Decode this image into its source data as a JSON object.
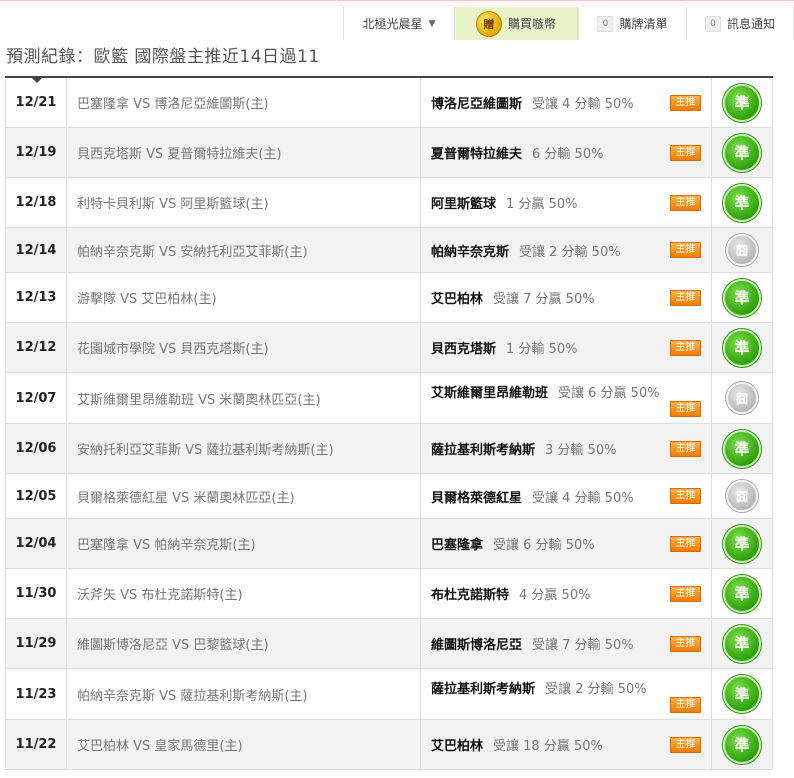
{
  "topbar": {
    "brand_label": "北極光晨星",
    "buy": {
      "coin_label": "贈",
      "label": "購買嗾幣"
    },
    "cart": {
      "count": "0",
      "label": "購牌清單"
    },
    "notice": {
      "count": "0",
      "label": "訊息通知"
    }
  },
  "page_title": "預測紀錄：歐籃 國際盤主推近14日過11",
  "badge_label": "主推",
  "rows": [
    {
      "date": "12/21",
      "match": "巴塞隆拿 VS 博洛尼亞維圖斯(主)",
      "pick_team": "博洛尼亞維圖斯",
      "pick_odds": "受讓 4 分輸 50%",
      "result": "準",
      "result_type": "win"
    },
    {
      "date": "12/19",
      "match": "貝西克塔斯 VS 夏普爾特拉維夫(主)",
      "pick_team": "夏普爾特拉維夫",
      "pick_odds": "6 分輸 50%",
      "result": "準",
      "result_type": "win"
    },
    {
      "date": "12/18",
      "match": "利特卡貝利斯 VS 阿里斯籃球(主)",
      "pick_team": "阿里斯籃球",
      "pick_odds": "1 分贏 50%",
      "result": "準",
      "result_type": "win"
    },
    {
      "date": "12/14",
      "match": "帕納辛奈克斯 VS 安納托利亞艾菲斯(主)",
      "pick_team": "帕納辛奈克斯",
      "pick_odds": "受讓 2 分輸 50%",
      "result": "囧",
      "result_type": "push"
    },
    {
      "date": "12/13",
      "match": "游擊隊 VS 艾巴柏林(主)",
      "pick_team": "艾巴柏林",
      "pick_odds": "受讓 7 分贏 50%",
      "result": "準",
      "result_type": "win"
    },
    {
      "date": "12/12",
      "match": "花園城市學院 VS 貝西克塔斯(主)",
      "pick_team": "貝西克塔斯",
      "pick_odds": "1 分輸 50%",
      "result": "準",
      "result_type": "win"
    },
    {
      "date": "12/07",
      "match": "艾斯維爾里昂維勒班 VS 米蘭奧林匹亞(主)",
      "pick_team": "艾斯維爾里昂維勒班",
      "pick_odds": "受讓 6 分贏 50%",
      "result": "囧",
      "result_type": "push"
    },
    {
      "date": "12/06",
      "match": "安納托利亞艾菲斯 VS 薩拉基利斯考納斯(主)",
      "pick_team": "薩拉基利斯考納斯",
      "pick_odds": "3 分輸 50%",
      "result": "準",
      "result_type": "win"
    },
    {
      "date": "12/05",
      "match": "貝爾格萊德紅星 VS 米蘭奧林匹亞(主)",
      "pick_team": "貝爾格萊德紅星",
      "pick_odds": "受讓 4 分輸 50%",
      "result": "囧",
      "result_type": "push"
    },
    {
      "date": "12/04",
      "match": "巴塞隆拿 VS 帕納辛奈克斯(主)",
      "pick_team": "巴塞隆拿",
      "pick_odds": "受讓 6 分輸 50%",
      "result": "準",
      "result_type": "win"
    },
    {
      "date": "11/30",
      "match": "沃斧矢 VS 布杜克諾斯特(主)",
      "pick_team": "布杜克諾斯特",
      "pick_odds": "4 分贏 50%",
      "result": "準",
      "result_type": "win"
    },
    {
      "date": "11/29",
      "match": "維圖斯博洛尼亞 VS 巴黎籃球(主)",
      "pick_team": "維圖斯博洛尼亞",
      "pick_odds": "受讓 7 分輸 50%",
      "result": "準",
      "result_type": "win"
    },
    {
      "date": "11/23",
      "match": "帕納辛奈克斯 VS 薩拉基利斯考納斯(主)",
      "pick_team": "薩拉基利斯考納斯",
      "pick_odds": "受讓 2 分輸 50%",
      "result": "準",
      "result_type": "win"
    },
    {
      "date": "11/22",
      "match": "艾巴柏林 VS 皇家馬德里(主)",
      "pick_team": "艾巴柏林",
      "pick_odds": "受讓 18 分贏 50%",
      "result": "準",
      "result_type": "win"
    }
  ]
}
